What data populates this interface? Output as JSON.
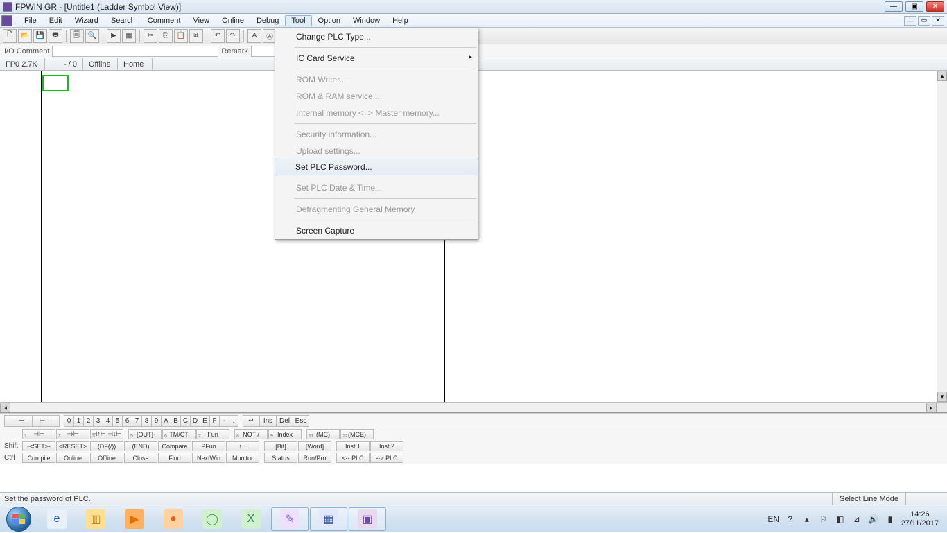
{
  "title": "FPWIN GR - [Untitle1 (Ladder Symbol View)]",
  "menubar": [
    "File",
    "Edit",
    "Wizard",
    "Search",
    "Comment",
    "View",
    "Online",
    "Debug",
    "Tool",
    "Option",
    "Window",
    "Help"
  ],
  "active_menu_index": 8,
  "dropdown": {
    "items": [
      {
        "label": "Change PLC Type...",
        "enabled": true
      },
      {
        "sep": true
      },
      {
        "label": "IC Card Service",
        "enabled": true,
        "submenu": true
      },
      {
        "sep": true
      },
      {
        "label": "ROM Writer...",
        "enabled": false
      },
      {
        "label": "ROM & RAM service...",
        "enabled": false
      },
      {
        "label": "Internal memory <=> Master memory...",
        "enabled": false
      },
      {
        "sep": true
      },
      {
        "label": "Security information...",
        "enabled": false
      },
      {
        "label": "Upload settings...",
        "enabled": false
      },
      {
        "label": "Set PLC Password...",
        "enabled": true,
        "highlighted": true
      },
      {
        "sep": true
      },
      {
        "label": "Set PLC Date & Time...",
        "enabled": false
      },
      {
        "sep": true
      },
      {
        "label": "Defragmenting General Memory",
        "enabled": false
      },
      {
        "sep": true
      },
      {
        "label": "Screen Capture",
        "enabled": true
      }
    ]
  },
  "commentbar": {
    "io_label": "I/O Comment",
    "remark_label": "Remark"
  },
  "statusstrip": {
    "plc": "FP0 2.7K",
    "steps": "- /      0",
    "mode": "Offline",
    "page": "Home"
  },
  "row_tools": {
    "left_syms": [
      "—⊣ ",
      "⊢—"
    ],
    "nums": [
      "0",
      "1",
      "2",
      "3",
      "4",
      "5",
      "6",
      "7",
      "8",
      "9",
      "A",
      "B",
      "C",
      "D",
      "E",
      "F",
      "-",
      "."
    ],
    "right": [
      "↵",
      "Ins",
      "Del",
      "Esc"
    ]
  },
  "fn_rows": [
    {
      "lbl": "",
      "cells": [
        "⊣⊢",
        "⊣⁄⊢",
        "⊣↑⊢ ⊣↓⊢",
        "",
        "-[OUT]-",
        "TM/CT",
        "Fun",
        "",
        "NOT /",
        "Index",
        "",
        "(MC)",
        "(MCE)"
      ]
    },
    {
      "lbl": "Shift",
      "cells": [
        "-<SET>-",
        "<RESET>",
        "(DF(/))",
        "(END)",
        "Compare",
        "PFun",
        "↑  ↓",
        "",
        "[Bit]",
        "[Word]",
        "",
        "Inst.1",
        "Inst.2"
      ]
    },
    {
      "lbl": "Ctrl",
      "cells": [
        "Compile",
        "Online",
        "Offline",
        "Close",
        "Find",
        "NextWin",
        "Monitor",
        "",
        "Status",
        "Run/Pro",
        "",
        "<-- PLC",
        "--> PLC"
      ]
    }
  ],
  "fn_subs": [
    "1",
    "2",
    "3",
    "4",
    "5",
    "6",
    "7",
    "",
    "8",
    "9",
    "",
    "11",
    "12"
  ],
  "statusbar": {
    "left": "Set the password of PLC.",
    "mode": "Select Line Mode"
  },
  "tray": {
    "lang": "EN",
    "time": "14:26",
    "date": "27/11/2017"
  },
  "task_icons": [
    {
      "name": "ie",
      "bg": "#e8f0fa",
      "glyph": "e",
      "color": "#2060c0"
    },
    {
      "name": "explorer",
      "bg": "#ffe090",
      "glyph": "▥",
      "color": "#c08020"
    },
    {
      "name": "wmp",
      "bg": "#ffb060",
      "glyph": "▶",
      "color": "#e07000"
    },
    {
      "name": "firefox",
      "bg": "#ffd0a0",
      "glyph": "●",
      "color": "#e06020"
    },
    {
      "name": "utorrent",
      "bg": "#d0f0d0",
      "glyph": "◯",
      "color": "#40a040"
    },
    {
      "name": "excel",
      "bg": "#d0f0d0",
      "glyph": "X",
      "color": "#208040"
    },
    {
      "name": "paint",
      "bg": "#f0e0ff",
      "glyph": "✎",
      "color": "#8060c0",
      "active": true
    },
    {
      "name": "app1",
      "bg": "#e0e8ff",
      "glyph": "▦",
      "color": "#4060a0",
      "active": true
    },
    {
      "name": "fpwin",
      "bg": "#e8d8f0",
      "glyph": "▣",
      "color": "#6a4aa0",
      "active": true
    }
  ]
}
